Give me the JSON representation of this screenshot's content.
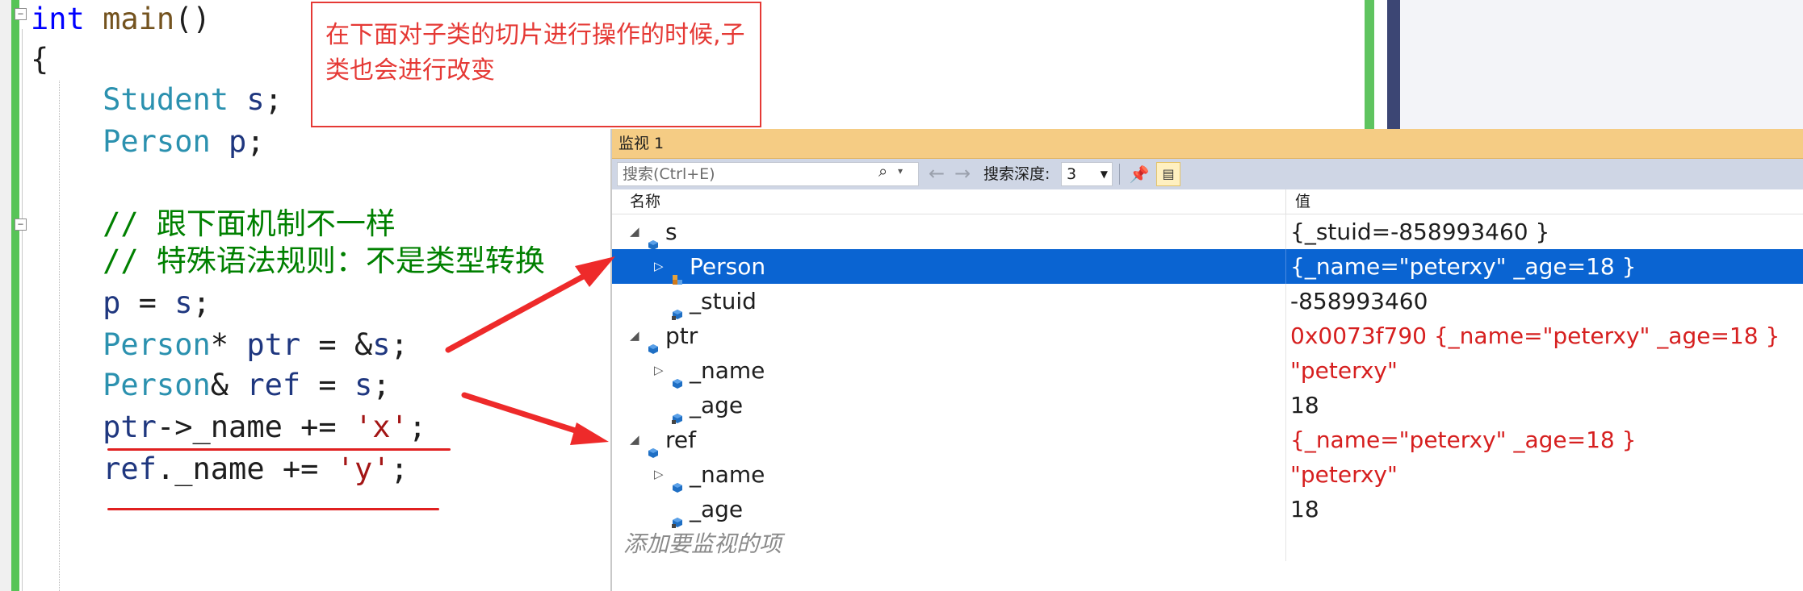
{
  "editor": {
    "lines": [
      {
        "parts": [
          {
            "t": "int",
            "c": "kw"
          },
          {
            "t": " "
          },
          {
            "t": "main",
            "c": "fn"
          },
          {
            "t": "()"
          }
        ]
      },
      {
        "parts": [
          {
            "t": "{"
          }
        ]
      },
      {
        "parts": [
          {
            "t": "    "
          },
          {
            "t": "Student",
            "c": "ty"
          },
          {
            "t": " "
          },
          {
            "t": "s",
            "c": "lv"
          },
          {
            "t": ";"
          }
        ]
      },
      {
        "parts": [
          {
            "t": "    "
          },
          {
            "t": "Person",
            "c": "ty"
          },
          {
            "t": " "
          },
          {
            "t": "p",
            "c": "lv"
          },
          {
            "t": ";"
          }
        ]
      },
      {
        "parts": [
          {
            "t": ""
          }
        ]
      },
      {
        "parts": [
          {
            "t": "    "
          },
          {
            "t": "// 跟下面机制不一样",
            "c": "cm"
          }
        ]
      },
      {
        "parts": [
          {
            "t": "    "
          },
          {
            "t": "// 特殊语法规则：不是类型转换",
            "c": "cm"
          }
        ]
      },
      {
        "parts": [
          {
            "t": "    "
          },
          {
            "t": "p",
            "c": "lv"
          },
          {
            "t": " = "
          },
          {
            "t": "s",
            "c": "lv"
          },
          {
            "t": ";"
          }
        ]
      },
      {
        "parts": [
          {
            "t": "    "
          },
          {
            "t": "Person",
            "c": "ty"
          },
          {
            "t": "* "
          },
          {
            "t": "ptr",
            "c": "lv"
          },
          {
            "t": " = &"
          },
          {
            "t": "s",
            "c": "lv"
          },
          {
            "t": ";"
          }
        ]
      },
      {
        "parts": [
          {
            "t": "    "
          },
          {
            "t": "Person",
            "c": "ty"
          },
          {
            "t": "& "
          },
          {
            "t": "ref",
            "c": "lv"
          },
          {
            "t": " = "
          },
          {
            "t": "s",
            "c": "lv"
          },
          {
            "t": ";"
          }
        ]
      },
      {
        "parts": [
          {
            "t": "    "
          },
          {
            "t": "ptr",
            "c": "lv"
          },
          {
            "t": "->_name += "
          },
          {
            "t": "'x'",
            "c": "st"
          },
          {
            "t": ";"
          }
        ]
      },
      {
        "parts": [
          {
            "t": "    "
          },
          {
            "t": "ref",
            "c": "lv"
          },
          {
            "t": "._name += "
          },
          {
            "t": "'y'",
            "c": "st"
          },
          {
            "t": ";"
          }
        ]
      }
    ]
  },
  "note": {
    "text": "在下面对子类的切片进行操作的时候,子类也会进行改变"
  },
  "watch": {
    "title": "监视 1",
    "search_placeholder": "搜索(Ctrl+E)",
    "depth_label": "搜索深度:",
    "depth_value": "3",
    "col_name": "名称",
    "col_value": "值",
    "add_item": "添加要监视的项",
    "rows": [
      {
        "indent": 0,
        "expander": "expanded",
        "icon": "object-icon",
        "name": "s",
        "value": "{_stuid=-858993460 }",
        "changed": false,
        "selected": false
      },
      {
        "indent": 1,
        "expander": "collapsed",
        "icon": "base-class-icon",
        "name": "Person",
        "value": "{_name=\"peterxy\" _age=18 }",
        "changed": false,
        "selected": true
      },
      {
        "indent": 1,
        "expander": "none",
        "icon": "field-icon",
        "name": "_stuid",
        "value": "-858993460",
        "changed": false,
        "selected": false
      },
      {
        "indent": 0,
        "expander": "expanded",
        "icon": "object-icon",
        "name": "ptr",
        "value": "0x0073f790 {_name=\"peterxy\" _age=18 }",
        "changed": true,
        "selected": false
      },
      {
        "indent": 1,
        "expander": "collapsed",
        "icon": "object-icon",
        "name": "_name",
        "value": "\"peterxy\"",
        "changed": true,
        "selected": false
      },
      {
        "indent": 1,
        "expander": "none",
        "icon": "field-icon",
        "name": "_age",
        "value": "18",
        "changed": false,
        "selected": false
      },
      {
        "indent": 0,
        "expander": "expanded",
        "icon": "object-icon",
        "name": "ref",
        "value": "{_name=\"peterxy\" _age=18 }",
        "changed": true,
        "selected": false
      },
      {
        "indent": 1,
        "expander": "collapsed",
        "icon": "object-icon",
        "name": "_name",
        "value": "\"peterxy\"",
        "changed": true,
        "selected": false
      },
      {
        "indent": 1,
        "expander": "none",
        "icon": "field-icon",
        "name": "_age",
        "value": "18",
        "changed": false,
        "selected": false
      }
    ]
  },
  "colors": {
    "annotation": "#e53935",
    "watch_title_bg": "#f5cc84",
    "toolbar_bg": "#cfd6e5",
    "selection": "#0a64d2",
    "changed_value": "#d61f1f"
  }
}
